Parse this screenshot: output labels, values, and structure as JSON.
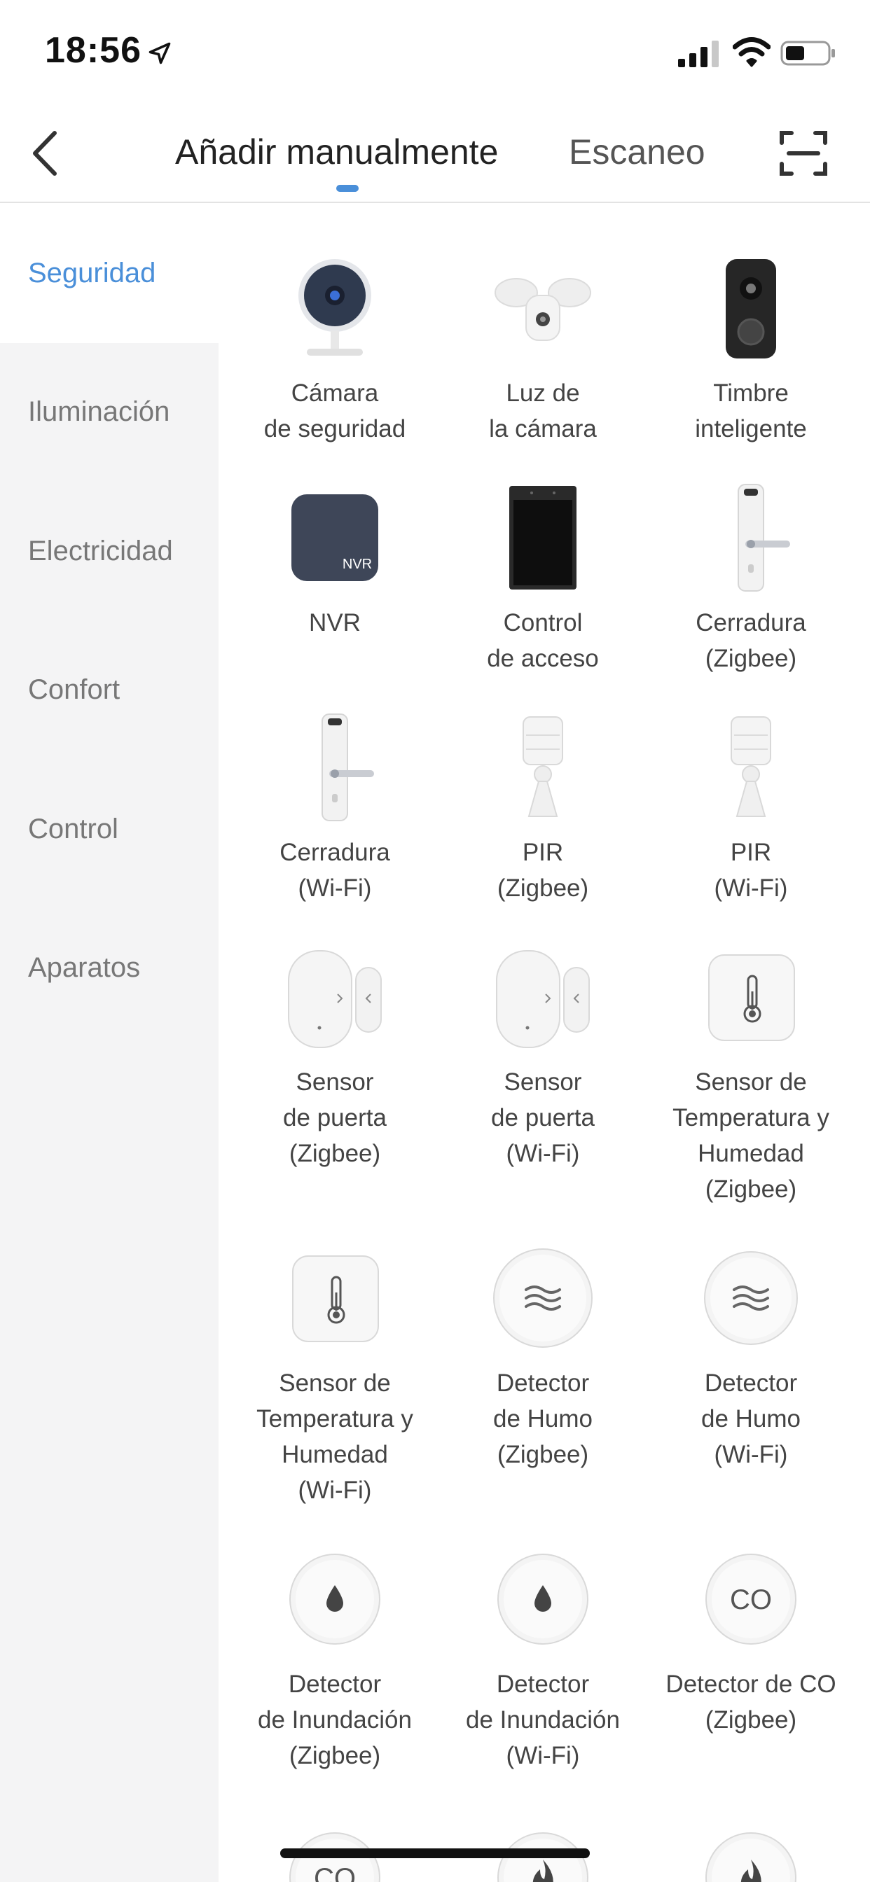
{
  "status": {
    "time": "18:56"
  },
  "header": {
    "tab_manual": "Añadir manualmente",
    "tab_scan": "Escaneo"
  },
  "sidebar": {
    "items": [
      {
        "label": "Seguridad"
      },
      {
        "label": "Iluminación"
      },
      {
        "label": "Electricidad"
      },
      {
        "label": "Confort"
      },
      {
        "label": "Control"
      },
      {
        "label": "Aparatos"
      }
    ]
  },
  "devices": [
    {
      "label": "Cámara\nde seguridad",
      "icon": "security-camera-icon"
    },
    {
      "label": "Luz de\nla cámara",
      "icon": "floodlight-camera-icon"
    },
    {
      "label": "Timbre\ninteligente",
      "icon": "doorbell-icon"
    },
    {
      "label": "NVR",
      "icon": "nvr-icon",
      "badge": "NVR"
    },
    {
      "label": "Control\nde acceso",
      "icon": "access-control-icon"
    },
    {
      "label": "Cerradura\n(Zigbee)",
      "icon": "door-lock-icon"
    },
    {
      "label": "Cerradura\n(Wi-Fi)",
      "icon": "door-lock-icon"
    },
    {
      "label": "PIR\n(Zigbee)",
      "icon": "pir-sensor-icon"
    },
    {
      "label": "PIR\n(Wi-Fi)",
      "icon": "pir-sensor-icon"
    },
    {
      "label": "Sensor\nde puerta\n(Zigbee)",
      "icon": "door-sensor-icon"
    },
    {
      "label": "Sensor\nde puerta\n(Wi-Fi)",
      "icon": "door-sensor-icon"
    },
    {
      "label": "Sensor de\nTemperatura y\nHumedad\n(Zigbee)",
      "icon": "thermometer-icon"
    },
    {
      "label": "Sensor de\nTemperatura y\nHumedad\n(Wi-Fi)",
      "icon": "thermometer-icon"
    },
    {
      "label": "Detector\nde Humo\n(Zigbee)",
      "icon": "smoke-detector-icon"
    },
    {
      "label": "Detector\nde Humo\n(Wi-Fi)",
      "icon": "smoke-detector-icon"
    },
    {
      "label": "Detector\nde Inundación\n(Zigbee)",
      "icon": "water-drop-icon"
    },
    {
      "label": "Detector\nde Inundación\n(Wi-Fi)",
      "icon": "water-drop-icon"
    },
    {
      "label": "Detector de CO\n(Zigbee)",
      "icon": "co-detector-icon",
      "badge": "CO"
    }
  ],
  "partial_row": [
    {
      "icon": "co-detector-icon",
      "badge": "CO"
    },
    {
      "icon": "flame-icon"
    },
    {
      "icon": "flame-icon"
    }
  ],
  "colors": {
    "accent": "#4a8fd9",
    "sidebar_bg": "#f4f4f5",
    "text": "#444444"
  }
}
